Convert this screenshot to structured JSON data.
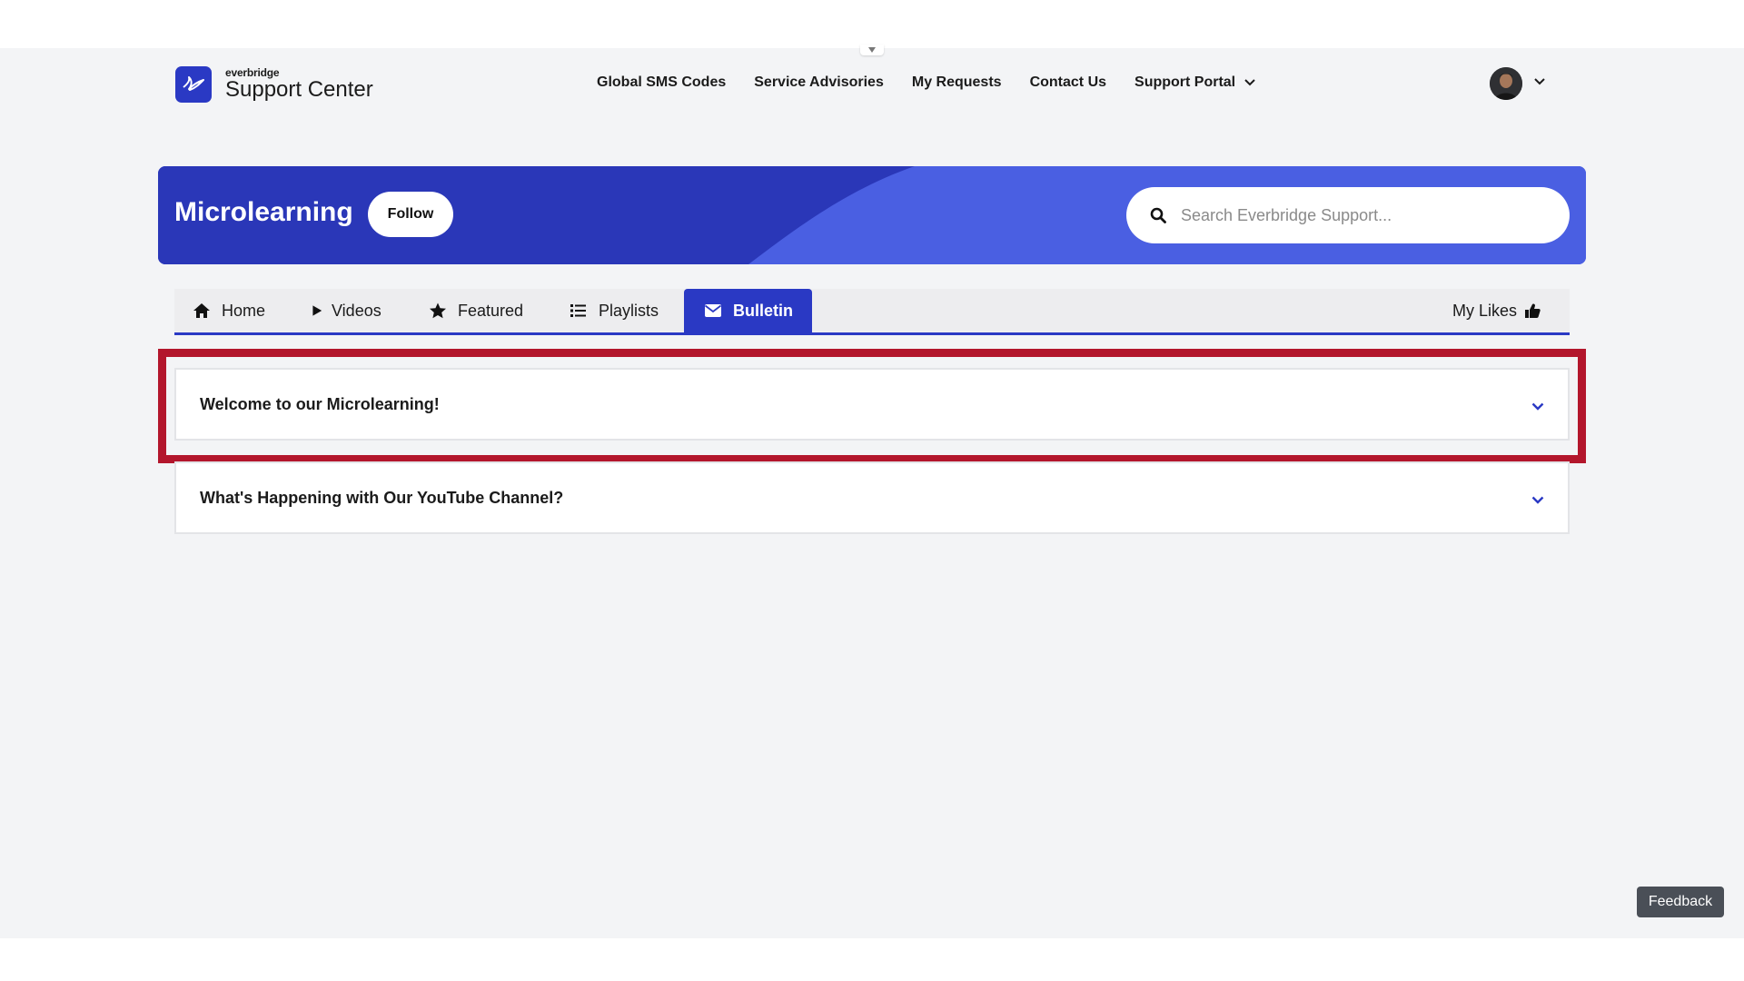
{
  "header": {
    "logo_small": "everbridge",
    "logo_title": "Support Center",
    "nav": [
      {
        "label": "Global SMS Codes"
      },
      {
        "label": "Service Advisories"
      },
      {
        "label": "My Requests"
      },
      {
        "label": "Contact Us"
      },
      {
        "label": "Support Portal"
      }
    ]
  },
  "banner": {
    "title": "Microlearning",
    "follow_label": "Follow",
    "search_placeholder": "Search Everbridge Support..."
  },
  "tabs": [
    {
      "label": "Home",
      "icon": "home-icon"
    },
    {
      "label": "Videos",
      "icon": "play-icon"
    },
    {
      "label": "Featured",
      "icon": "star-icon"
    },
    {
      "label": "Playlists",
      "icon": "list-icon"
    },
    {
      "label": "Bulletin",
      "icon": "envelope-icon",
      "active": true
    }
  ],
  "my_likes": "My Likes",
  "accordions": [
    {
      "title": "Welcome to our Microlearning!"
    },
    {
      "title": "What's Happening with Our YouTube Channel?"
    }
  ],
  "feedback_label": "Feedback",
  "colors": {
    "brand": "#2a39c4",
    "banner_light": "#4a5fe2",
    "highlight": "#b3162c",
    "page_bg": "#f3f4f6"
  }
}
